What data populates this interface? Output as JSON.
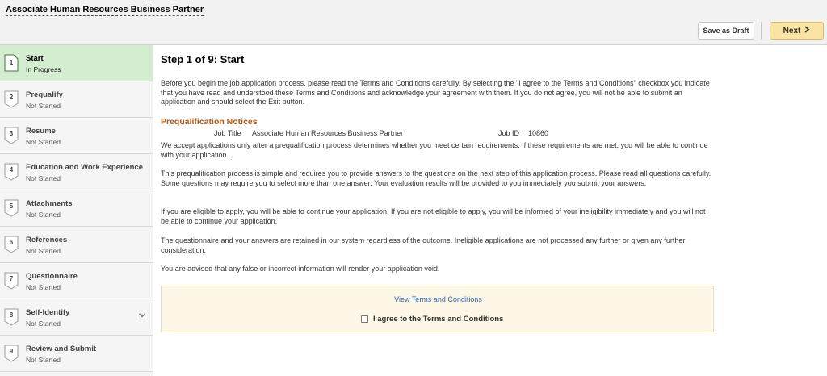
{
  "header": {
    "title": "Associate Human Resources Business Partner",
    "save_draft_label": "Save as Draft",
    "next_label": "Next"
  },
  "steps": [
    {
      "number": "1",
      "label": "Start",
      "status": "In Progress",
      "active": true
    },
    {
      "number": "2",
      "label": "Prequalify",
      "status": "Not Started"
    },
    {
      "number": "3",
      "label": "Resume",
      "status": "Not Started"
    },
    {
      "number": "4",
      "label": "Education and Work Experience",
      "status": "Not Started"
    },
    {
      "number": "5",
      "label": "Attachments",
      "status": "Not Started"
    },
    {
      "number": "6",
      "label": "References",
      "status": "Not Started"
    },
    {
      "number": "7",
      "label": "Questionnaire",
      "status": "Not Started"
    },
    {
      "number": "8",
      "label": "Self-Identify",
      "status": "Not Started",
      "expandable": true
    },
    {
      "number": "9",
      "label": "Review and Submit",
      "status": "Not Started"
    }
  ],
  "main": {
    "title": "Step 1 of 9: Start",
    "intro": "Before you begin the job application process, please read the Terms and Conditions carefully. By selecting the \"I agree to the Terms and Conditions\" checkbox you indicate that you have read and understood these Terms and Conditions and acknowledge your agreement with them. If you do not agree, you will not be able to submit an application and should select the Exit button.",
    "section_heading": "Prequalification Notices",
    "job_title_label": "Job Title",
    "job_title_value": "Associate Human Resources Business Partner",
    "job_id_label": "Job ID",
    "job_id_value": "10860",
    "para1": "We accept applications only after a prequalification process determines whether you meet certain requirements. If these requirements are met, you will be able to continue with your application.",
    "para2": "This prequalification process is simple and requires you to provide answers to the questions on the next step of this application process. Please read all questions carefully. Some questions may require you to select more than one answer. Your evaluation results will be provided to you immediately you submit your answers.",
    "para3": "If you are eligible to apply, you will be able to continue your application. If you are not eligible to apply, you will be informed of your ineligibility immediately and you will not be able to continue your application.",
    "para4": "The questionnaire and your answers are retained in our system regardless of the outcome. Ineligible applications are not processed any further or given any further consideration.",
    "para5": "You are advised that any false or incorrect information will render your application void."
  },
  "terms": {
    "link_label": "View Terms and Conditions",
    "checkbox_label": "I agree to the Terms and Conditions",
    "checked": false
  },
  "colors": {
    "active_step": "#d4eccf",
    "primary_button": "#fbe3a4",
    "heading_accent": "#b05a1a",
    "link": "#2e5fa6",
    "terms_box": "#fdf7e8"
  },
  "icons": {
    "next_chevron": "chevron-right-icon",
    "expand_chevron": "chevron-down-icon"
  }
}
